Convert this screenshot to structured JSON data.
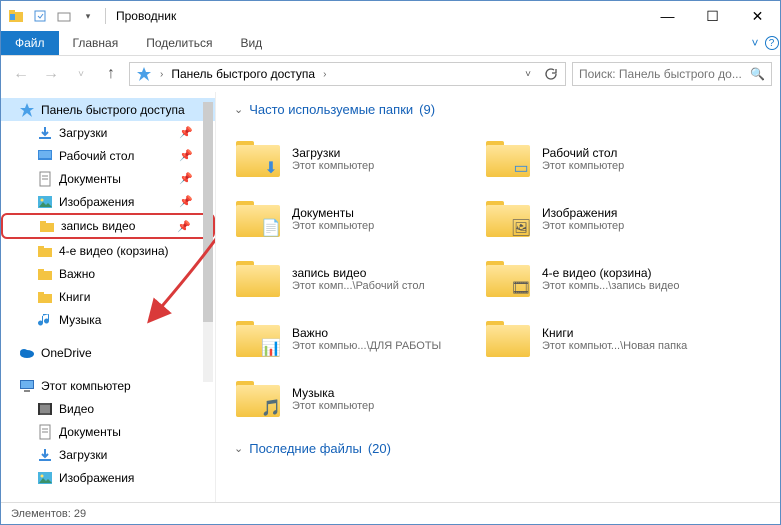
{
  "window": {
    "title": "Проводник"
  },
  "ribbon": {
    "file": "Файл",
    "tabs": [
      "Главная",
      "Поделиться",
      "Вид"
    ]
  },
  "address": {
    "crumb": "Панель быстрого доступа",
    "search_placeholder": "Поиск: Панель быстрого до..."
  },
  "tree": {
    "quick_access": "Панель быстрого доступа",
    "items": [
      {
        "label": "Загрузки",
        "icon": "downloads",
        "pinned": true
      },
      {
        "label": "Рабочий стол",
        "icon": "desktop",
        "pinned": true
      },
      {
        "label": "Документы",
        "icon": "documents",
        "pinned": true
      },
      {
        "label": "Изображения",
        "icon": "pictures",
        "pinned": true
      },
      {
        "label": "запись видео",
        "icon": "folder",
        "pinned": true,
        "highlighted": true
      },
      {
        "label": "4-е видео (корзина)",
        "icon": "folder"
      },
      {
        "label": "Важно",
        "icon": "folder"
      },
      {
        "label": "Книги",
        "icon": "folder"
      },
      {
        "label": "Музыка",
        "icon": "music"
      }
    ],
    "onedrive": "OneDrive",
    "this_pc": "Этот компьютер",
    "pc_items": [
      {
        "label": "Видео",
        "icon": "videos"
      },
      {
        "label": "Документы",
        "icon": "documents"
      },
      {
        "label": "Загрузки",
        "icon": "downloads"
      },
      {
        "label": "Изображения",
        "icon": "pictures"
      }
    ]
  },
  "content": {
    "frequent_label": "Часто используемые папки",
    "frequent_count": "(9)",
    "recent_label": "Последние файлы",
    "recent_count": "(20)",
    "folders": [
      {
        "name": "Загрузки",
        "path": "Этот компьютер",
        "overlay": "⬇",
        "oc": "#3a8adb"
      },
      {
        "name": "Рабочий стол",
        "path": "Этот компьютер",
        "overlay": "▭",
        "oc": "#3a8adb"
      },
      {
        "name": "Документы",
        "path": "Этот компьютер",
        "overlay": "📄",
        "oc": ""
      },
      {
        "name": "Изображения",
        "path": "Этот компьютер",
        "overlay": "🖼",
        "oc": ""
      },
      {
        "name": "запись видео",
        "path": "Этот комп...\\Рабочий стол",
        "overlay": "",
        "oc": ""
      },
      {
        "name": "4-е видео (корзина)",
        "path": "Этот компь...\\запись видео",
        "overlay": "🎞",
        "oc": ""
      },
      {
        "name": "Важно",
        "path": "Этот компью...\\ДЛЯ РАБОТЫ",
        "overlay": "📊",
        "oc": ""
      },
      {
        "name": "Книги",
        "path": "Этот компьют...\\Новая папка",
        "overlay": "",
        "oc": ""
      },
      {
        "name": "Музыка",
        "path": "Этот компьютер",
        "overlay": "🎵",
        "oc": "#3a8adb"
      }
    ]
  },
  "status": {
    "elements_label": "Элементов:",
    "elements_count": "29"
  }
}
